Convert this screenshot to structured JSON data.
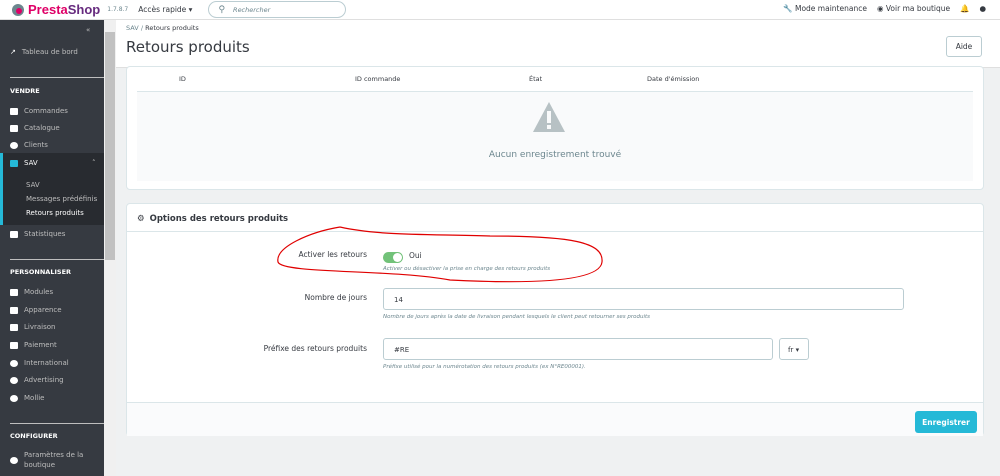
{
  "header": {
    "brand": "PrestaShop",
    "brand_a": "Presta",
    "brand_b": "Shop",
    "version": "1.7.8.7",
    "quick_access": "Accès rapide ▾",
    "search_placeholder": "Rechercher",
    "maintenance": "Mode maintenance",
    "view_shop": "Voir ma boutique"
  },
  "sidebar": {
    "dashboard": "Tableau de bord",
    "sections": {
      "sell": "VENDRE",
      "customize": "PERSONNALISER",
      "configure": "CONFIGURER"
    },
    "sell_items": [
      "Commandes",
      "Catalogue",
      "Clients",
      "SAV"
    ],
    "sav_sub": [
      "SAV",
      "Messages prédéfinis",
      "Retours produits"
    ],
    "stats": "Statistiques",
    "customize_items": [
      "Modules",
      "Apparence",
      "Livraison",
      "Paiement",
      "International",
      "Advertising",
      "Mollie"
    ],
    "configure_items": [
      "Paramètres de la boutique"
    ]
  },
  "breadcrumb": {
    "parent": "SAV",
    "sep": "/",
    "current": "Retours produits"
  },
  "page": {
    "title": "Retours produits",
    "help": "Aide"
  },
  "table": {
    "columns": [
      "ID",
      "ID commande",
      "État",
      "Date d'émission"
    ],
    "empty": "Aucun enregistrement trouvé"
  },
  "options": {
    "title": "Options des retours produits",
    "enable": {
      "label": "Activer les retours",
      "value": "Oui",
      "help": "Activer ou désactiver la prise en charge des retours produits",
      "on": true
    },
    "days": {
      "label": "Nombre de jours",
      "value": "14",
      "help": "Nombre de jours après la date de livraison pendant lesquels le client peut retourner ses produits"
    },
    "prefix": {
      "label": "Préfixe des retours produits",
      "value": "#RE",
      "lang": "fr ▾",
      "help": "Préfixe utilisé pour la numérotation des retours produits (ex N°RE00001)."
    },
    "save": "Enregistrer"
  },
  "colors": {
    "accent": "#25b9d7",
    "toggle": "#72c279",
    "annotation": "#e00000"
  }
}
